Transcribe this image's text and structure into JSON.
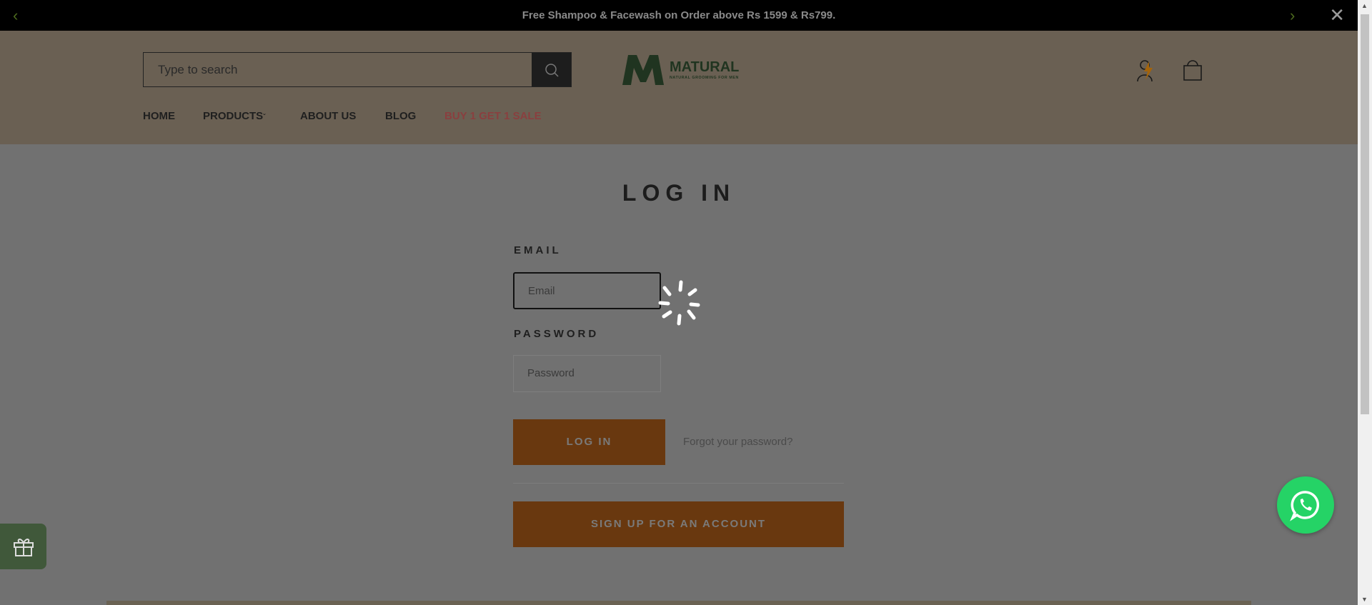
{
  "announcement": {
    "text": "Free Shampoo & Facewash on Order above Rs 1599 & Rs799."
  },
  "search": {
    "placeholder": "Type to search"
  },
  "logo": {
    "letter": "M",
    "name": "MATURAL",
    "tagline": "NATURAL GROOMING FOR MEN"
  },
  "nav": [
    {
      "label": "HOME"
    },
    {
      "label": "PRODUCTS"
    },
    {
      "label": "ABOUT US"
    },
    {
      "label": "BLOG"
    },
    {
      "label": "BUY 1 GET 1 SALE"
    }
  ],
  "login": {
    "title": "LOG IN",
    "email_label": "EMAIL",
    "email_placeholder": "Email",
    "password_label": "PASSWORD",
    "password_placeholder": "Password",
    "login_button": "LOG IN",
    "forgot_link": "Forgot your password?",
    "signup_button": "SIGN UP FOR AN ACCOUNT"
  },
  "colors": {
    "accent": "#d2781e",
    "sale": "#e0435a",
    "whatsapp": "#25d366",
    "gift": "#4e7a45"
  }
}
